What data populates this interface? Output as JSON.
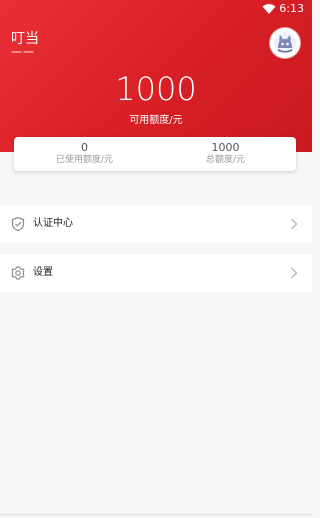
{
  "status_bar": {
    "time": "6:13"
  },
  "header": {
    "user_name": "叮当",
    "user_sub": "一一",
    "avatar_icon": "cat-avatar-icon"
  },
  "limit": {
    "value": "1000",
    "label": "可用额度/元"
  },
  "stats": {
    "used_value": "0",
    "used_label": "已使用额度/元",
    "total_value": "1000",
    "total_label": "总额度/元"
  },
  "menu": {
    "items": [
      {
        "label": "认证中心",
        "icon": "shield-check-icon"
      },
      {
        "label": "设置",
        "icon": "gear-icon"
      }
    ]
  },
  "colors": {
    "brand_red": "#e02a30",
    "background": "#f6f6f6"
  }
}
